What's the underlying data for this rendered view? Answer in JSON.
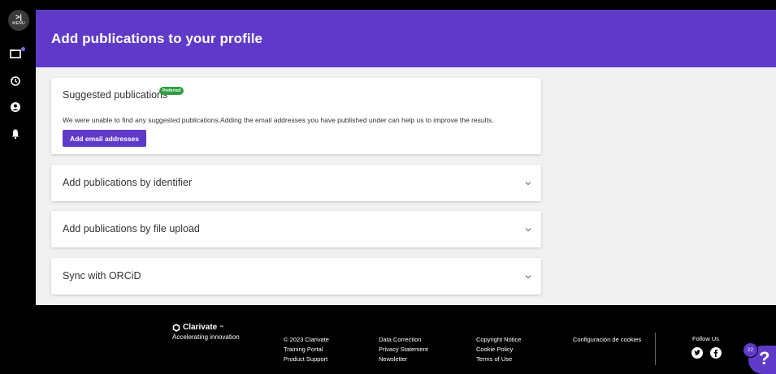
{
  "rail": {
    "menu_arrow": ">|",
    "menu_label": "MENU",
    "icons": [
      "folder-icon",
      "history-icon",
      "account-icon",
      "bell-icon"
    ]
  },
  "page": {
    "title": "Add publications to your profile"
  },
  "suggested": {
    "title": "Suggested publications",
    "badge": "Preferred",
    "description": "We were unable to find any suggested publications.Adding the email addresses you have published under can help us to improve the results.",
    "button": "Add email addresses"
  },
  "accordions": [
    {
      "title": "Add publications by identifier"
    },
    {
      "title": "Add publications by file upload"
    },
    {
      "title": "Sync with ORCiD"
    }
  ],
  "footer": {
    "brand": "Clarivate",
    "brand_mark": "™",
    "tagline": "Accelerating innovation",
    "col1": [
      "© 2023 Clarivate",
      "Training Portal",
      "Product Support"
    ],
    "col2": [
      "Data Correction",
      "Privacy Statement",
      "Newsletter"
    ],
    "col3": [
      "Copyright Notice",
      "Cookie Policy",
      "Terms of Use"
    ],
    "cookie_settings": "Configuración de cookies",
    "follow_us": "Follow Us",
    "help_count": "22",
    "help_symbol": "?"
  },
  "colors": {
    "brand_purple": "#5f3ac9",
    "badge_green": "#2e9e3e",
    "background": "#f1f1f1"
  }
}
